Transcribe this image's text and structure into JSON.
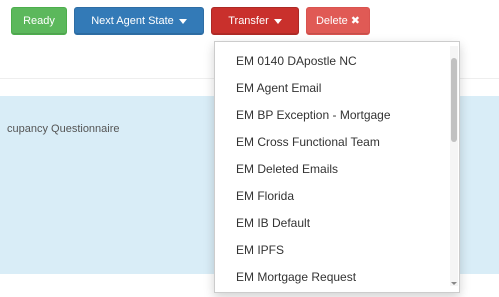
{
  "toolbar": {
    "ready_label": "Ready",
    "next_agent_state_label": "Next Agent State",
    "transfer_label": "Transfer",
    "delete_label": "Delete",
    "delete_icon": "✖"
  },
  "panel": {
    "title": "cupancy Questionnaire"
  },
  "transfer_dropdown": {
    "items": [
      "EM 0140 DApostle NC",
      "EM Agent Email",
      "EM BP Exception - Mortgage",
      "EM Cross Functional Team",
      "EM Deleted Emails",
      "EM Florida",
      "EM IB Default",
      "EM IPFS",
      "EM Mortgage Request"
    ]
  },
  "colors": {
    "ready": "#5cb85c",
    "next_agent_state": "#337ab7",
    "transfer": "#c9302c",
    "delete": "#e05a55",
    "panel_background": "#d9edf7"
  },
  "icons": {
    "next_agent_state": "caret-down-icon",
    "transfer": "caret-down-icon",
    "delete": "close-icon"
  }
}
